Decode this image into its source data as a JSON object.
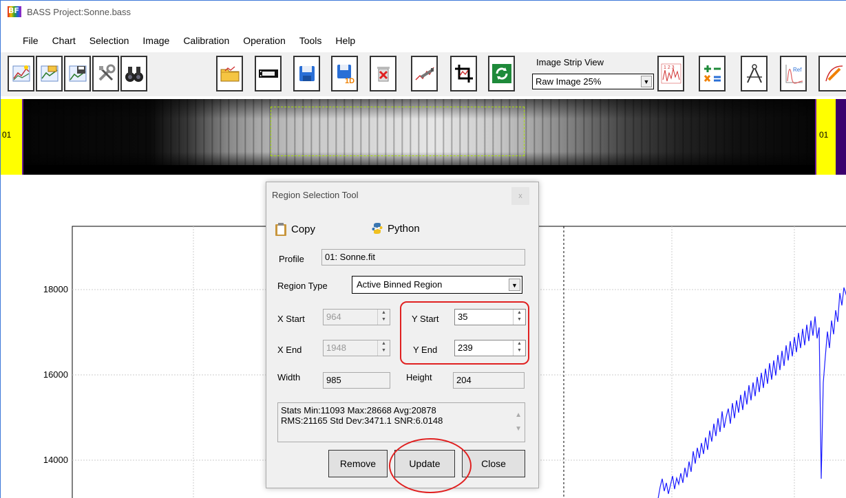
{
  "window": {
    "title": "BASS Project:Sonne.bass",
    "app_icon_text": "BF"
  },
  "menu": [
    "File",
    "Chart",
    "Selection",
    "Image",
    "Calibration",
    "Operation",
    "Tools",
    "Help"
  ],
  "toolbar": {
    "strip_view_label": "Image Strip View",
    "strip_view_value": "Raw Image 25%",
    "buttons": [
      "new-chart-icon",
      "open-chart-icon",
      "save-chart-icon",
      "settings-tools-icon",
      "binoculars-icon",
      "open-folder-icon",
      "film-strip-icon",
      "save-icon",
      "save-1d-icon",
      "delete-icon",
      "edit-curve-icon",
      "crop-icon",
      "refresh-icon",
      "numbered-chart-icon",
      "calculator-icon",
      "compass-icon",
      "reference-icon",
      "edit-chart-icon"
    ],
    "save1d_text": "1D",
    "ref_text": "Ref"
  },
  "image_strip": {
    "left_label": "01",
    "right_label": "01"
  },
  "chart": {
    "y_ticks": [
      "18000",
      "16000",
      "14000"
    ]
  },
  "dialog": {
    "title": "Region Selection Tool",
    "close": "x",
    "copy_label": "Copy",
    "python_label": "Python",
    "profile_label": "Profile",
    "profile_value": "01: Sonne.fit",
    "region_type_label": "Region Type",
    "region_type_value": "Active Binned Region",
    "x_start_label": "X Start",
    "x_start_value": "964",
    "x_end_label": "X End",
    "x_end_value": "1948",
    "y_start_label": "Y Start",
    "y_start_value": "35",
    "y_end_label": "Y End",
    "y_end_value": "239",
    "width_label": "Width",
    "width_value": "985",
    "height_label": "Height",
    "height_value": "204",
    "stats_line1": "Stats  Min:11093  Max:28668  Avg:20878",
    "stats_line2": "RMS:21165  Std Dev:3471.1  SNR:6.0148",
    "remove_label": "Remove",
    "update_label": "Update",
    "close_label": "Close"
  },
  "colors": {
    "accent_ring": "#e02020",
    "spectrum_line": "#1a1aff",
    "strip_marker": "#ffff00",
    "strip_border": "#6a1b9a"
  }
}
